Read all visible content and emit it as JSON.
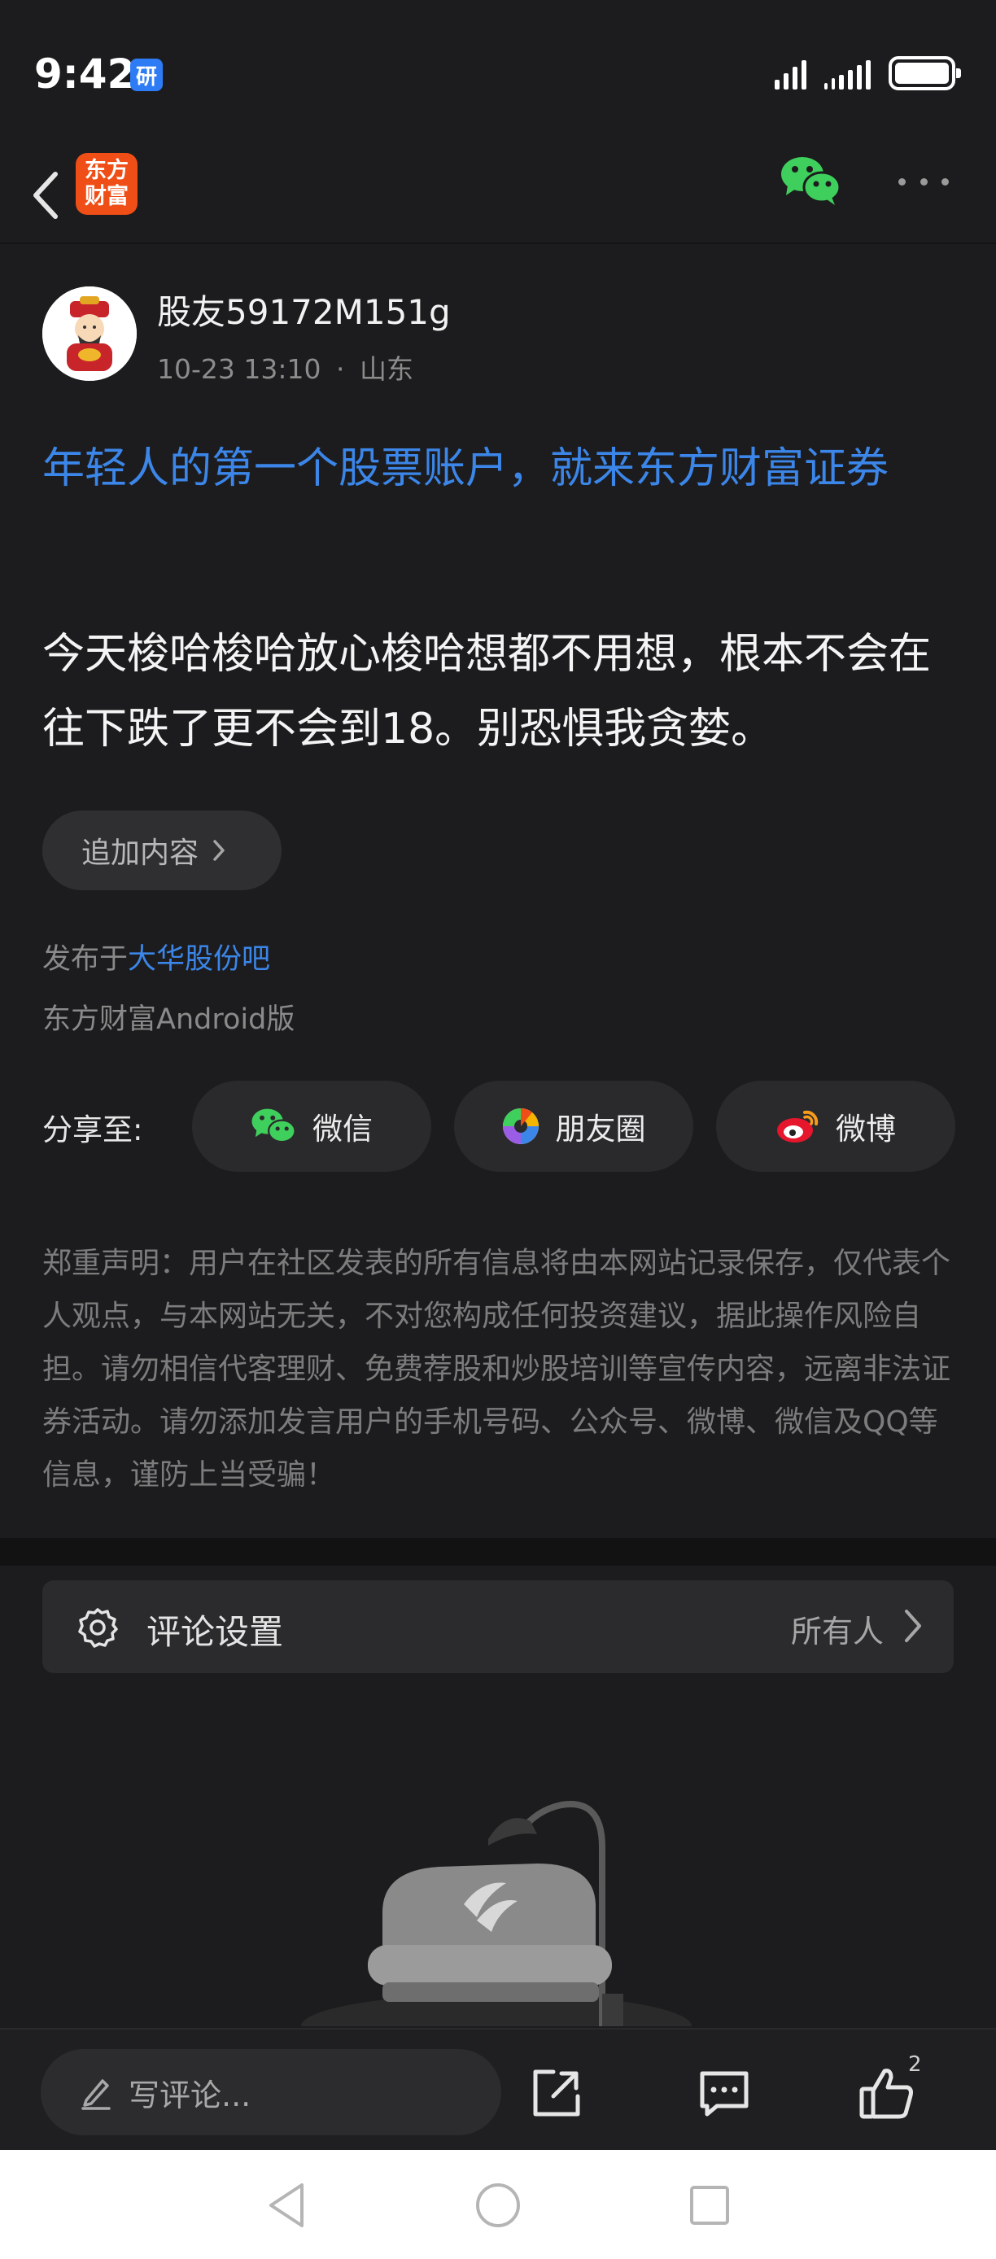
{
  "status_bar": {
    "time": "9:42",
    "badge": "研",
    "signal_levels": [
      0.4,
      0.6,
      0.8,
      1.0
    ],
    "battery_level": 1.0
  },
  "header": {
    "logo_line1": "东方",
    "logo_line2": "财富",
    "accent_color": "#ef4e16"
  },
  "post": {
    "username": "股友59172M151g",
    "date": "10-23 13:10",
    "separator": "·",
    "location": "山东",
    "ad_title": "年轻人的第一个股票账户，就来东方财富证券",
    "body": "今天梭哈梭哈放心梭哈想都不用想，根本不会在往下跌了更不会到18。别恐惧我贪婪。",
    "append_label": "追加内容",
    "published_prefix": "发布于",
    "published_bar": "大华股份吧",
    "client": "东方财富Android版",
    "link_color": "#3b86e8"
  },
  "share": {
    "label": "分享至:",
    "buttons": [
      {
        "label": "微信",
        "icon": "wechat-icon"
      },
      {
        "label": "朋友圈",
        "icon": "moments-icon"
      },
      {
        "label": "微博",
        "icon": "weibo-icon"
      }
    ]
  },
  "disclaimer": "郑重声明：用户在社区发表的所有信息将由本网站记录保存，仅代表个人观点，与本网站无关，不对您构成任何投资建议，据此操作风险自担。请勿相信代客理财、免费荐股和炒股培训等宣传内容，远离非法证券活动。请勿添加发言用户的手机号码、公众号、微博、微信及QQ等信息，谨防上当受骗！",
  "comment_settings": {
    "label": "评论设置",
    "value": "所有人"
  },
  "bottom_bar": {
    "comment_placeholder": "写评论...",
    "like_count": "2"
  }
}
